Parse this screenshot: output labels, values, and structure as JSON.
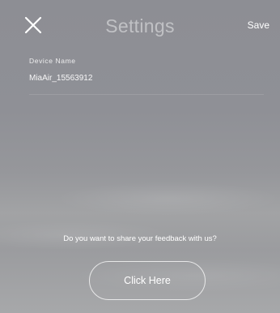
{
  "header": {
    "title": "Settings",
    "save_label": "Save",
    "close_icon": "close-icon"
  },
  "device": {
    "label": "Device Name",
    "value": "MiaAir_15563912"
  },
  "feedback": {
    "prompt": "Do you want to share your feedback with us?",
    "button_label": "Click Here"
  },
  "colors": {
    "background": "#8e8f94",
    "text": "#ffffff"
  }
}
